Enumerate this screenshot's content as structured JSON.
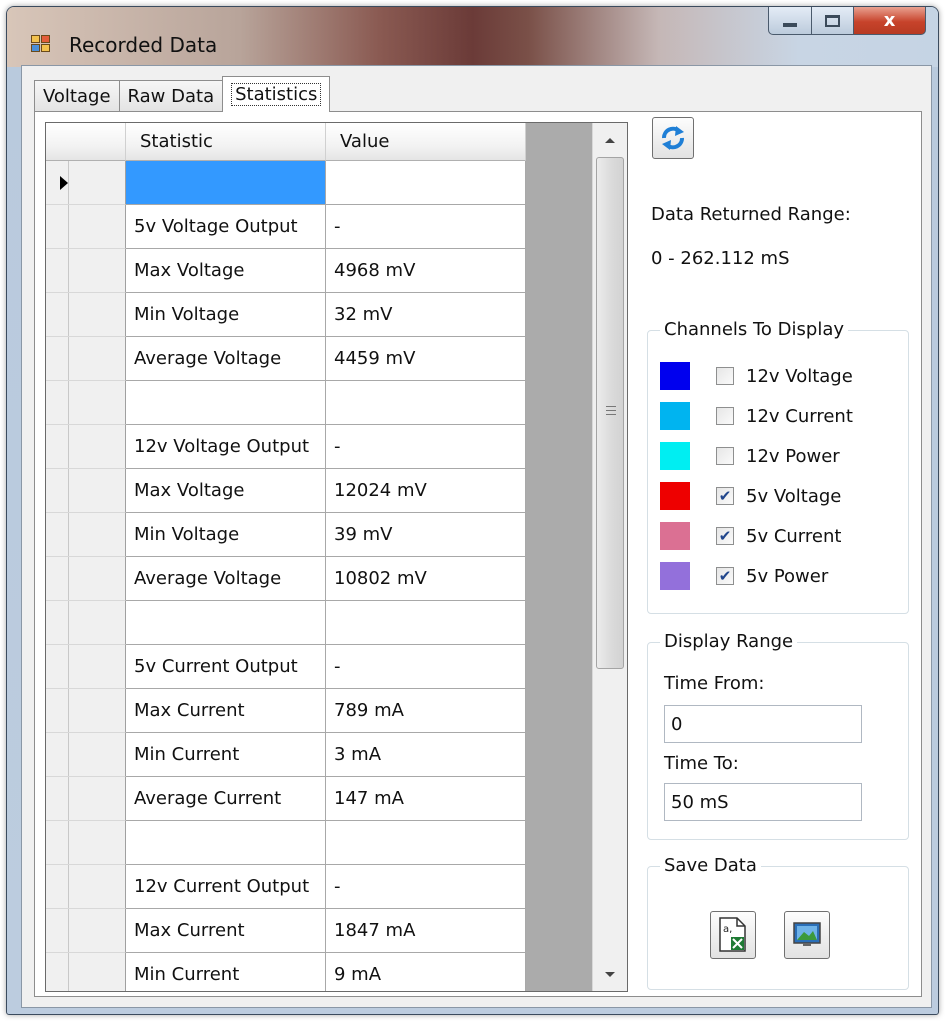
{
  "window": {
    "title": "Recorded Data",
    "close_glyph": "x"
  },
  "tabs": [
    {
      "label": "Voltage",
      "active": false
    },
    {
      "label": "Raw Data",
      "active": false
    },
    {
      "label": "Statistics",
      "active": true
    }
  ],
  "grid": {
    "columns": [
      "Statistic",
      "Value"
    ],
    "rows": [
      {
        "statistic": "",
        "value": "",
        "current": true
      },
      {
        "statistic": "5v Voltage Output",
        "value": "-"
      },
      {
        "statistic": "Max Voltage",
        "value": "4968 mV"
      },
      {
        "statistic": "Min Voltage",
        "value": "32 mV"
      },
      {
        "statistic": "Average Voltage",
        "value": "4459 mV"
      },
      {
        "statistic": "",
        "value": ""
      },
      {
        "statistic": "12v Voltage Output",
        "value": "-"
      },
      {
        "statistic": "Max Voltage",
        "value": "12024 mV"
      },
      {
        "statistic": "Min Voltage",
        "value": "39 mV"
      },
      {
        "statistic": "Average Voltage",
        "value": "10802 mV"
      },
      {
        "statistic": "",
        "value": ""
      },
      {
        "statistic": "5v Current Output",
        "value": "-"
      },
      {
        "statistic": "Max Current",
        "value": "789 mA"
      },
      {
        "statistic": "Min Current",
        "value": "3 mA"
      },
      {
        "statistic": "Average Current",
        "value": "147 mA"
      },
      {
        "statistic": "",
        "value": ""
      },
      {
        "statistic": "12v Current Output",
        "value": "-"
      },
      {
        "statistic": "Max Current",
        "value": "1847 mA"
      },
      {
        "statistic": "Min Current",
        "value": "9 mA"
      }
    ]
  },
  "info": {
    "range_label": "Data Returned Range:",
    "range_value": "0  -  262.112 mS"
  },
  "channels": {
    "title": "Channels To Display",
    "items": [
      {
        "label": "12v Voltage",
        "color": "#0000ee",
        "checked": false
      },
      {
        "label": "12v Current",
        "color": "#00b4f0",
        "checked": false
      },
      {
        "label": "12v Power",
        "color": "#00eef2",
        "checked": false
      },
      {
        "label": "5v Voltage",
        "color": "#ee0000",
        "checked": true
      },
      {
        "label": "5v Current",
        "color": "#db7093",
        "checked": true
      },
      {
        "label": "5v Power",
        "color": "#9370db",
        "checked": true
      }
    ]
  },
  "display_range": {
    "title": "Display Range",
    "time_from_label": "Time From:",
    "time_from_value": "0",
    "time_to_label": "Time To:",
    "time_to_value": "50 mS"
  },
  "save": {
    "title": "Save Data",
    "csv_icon": "csv-excel-icon",
    "image_icon": "save-image-icon"
  },
  "icons": {
    "refresh": "refresh-icon"
  }
}
